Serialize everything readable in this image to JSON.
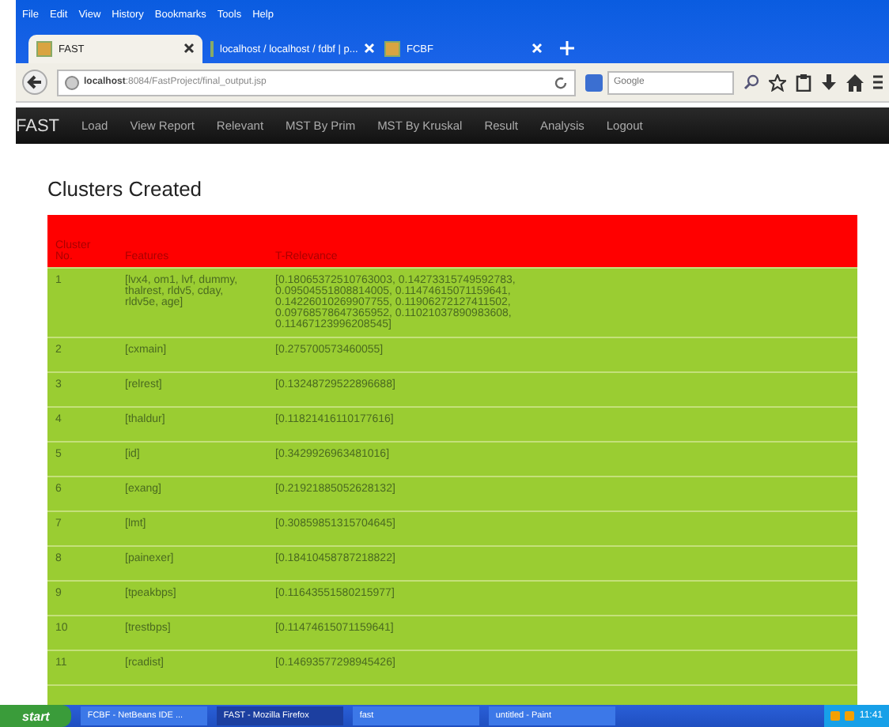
{
  "browser": {
    "menu": [
      "File",
      "Edit",
      "View",
      "History",
      "Bookmarks",
      "Tools",
      "Help"
    ],
    "tabs": [
      {
        "title": "FAST",
        "selected": true
      },
      {
        "title": "localhost / localhost / fdbf | p...",
        "selected": false
      },
      {
        "title": "FCBF",
        "selected": false
      }
    ],
    "address": {
      "host": "localhost",
      "path": ":8084/FastProject/final_output.jsp"
    },
    "search": {
      "placeholder": "Google"
    }
  },
  "navbar": {
    "brand": "FAST",
    "items": [
      "Load",
      "View Report",
      "Relevant",
      "MST By Prim",
      "MST By Kruskal",
      "Result",
      "Analysis",
      "Logout"
    ]
  },
  "heading": "Clusters Created",
  "table": {
    "columns": [
      "Cluster No.",
      "Features",
      "T-Relevance"
    ],
    "rows": [
      [
        "1",
        "[lvx4, om1, lvf, dummy, thalrest, rldv5, cday, rldv5e, age]",
        "[0.18065372510763003, 0.14273315749592783, 0.09504551808814005, 0.11474615071159641, 0.14226010269907755, 0.11906272127411502, 0.09768578647365952, 0.11021037890983608, 0.11467123996208545]"
      ],
      [
        "2",
        "[cxmain]",
        "[0.275700573460055]"
      ],
      [
        "3",
        "[relrest]",
        "[0.13248729522896688]"
      ],
      [
        "4",
        "[thaldur]",
        "[0.11821416110177616]"
      ],
      [
        "5",
        "[id]",
        "[0.3429926963481016]"
      ],
      [
        "6",
        "[exang]",
        "[0.21921885052628132]"
      ],
      [
        "7",
        "[lmt]",
        "[0.30859851315704645]"
      ],
      [
        "8",
        "[painexer]",
        "[0.18410458787218822]"
      ],
      [
        "9",
        "[tpeakbps]",
        "[0.11643551580215977]"
      ],
      [
        "10",
        "[trestbps]",
        "[0.11474615071159641]"
      ],
      [
        "11",
        "[rcadist]",
        "[0.14693577298945426]"
      ]
    ]
  },
  "taskbar": {
    "start": "start",
    "items": [
      {
        "title": "FCBF - NetBeans IDE ...",
        "selected": false
      },
      {
        "title": "FAST - Mozilla Firefox",
        "selected": true
      },
      {
        "title": "fast",
        "selected": false
      },
      {
        "title": "untitled - Paint",
        "selected": false
      }
    ],
    "clock": "11:41"
  }
}
